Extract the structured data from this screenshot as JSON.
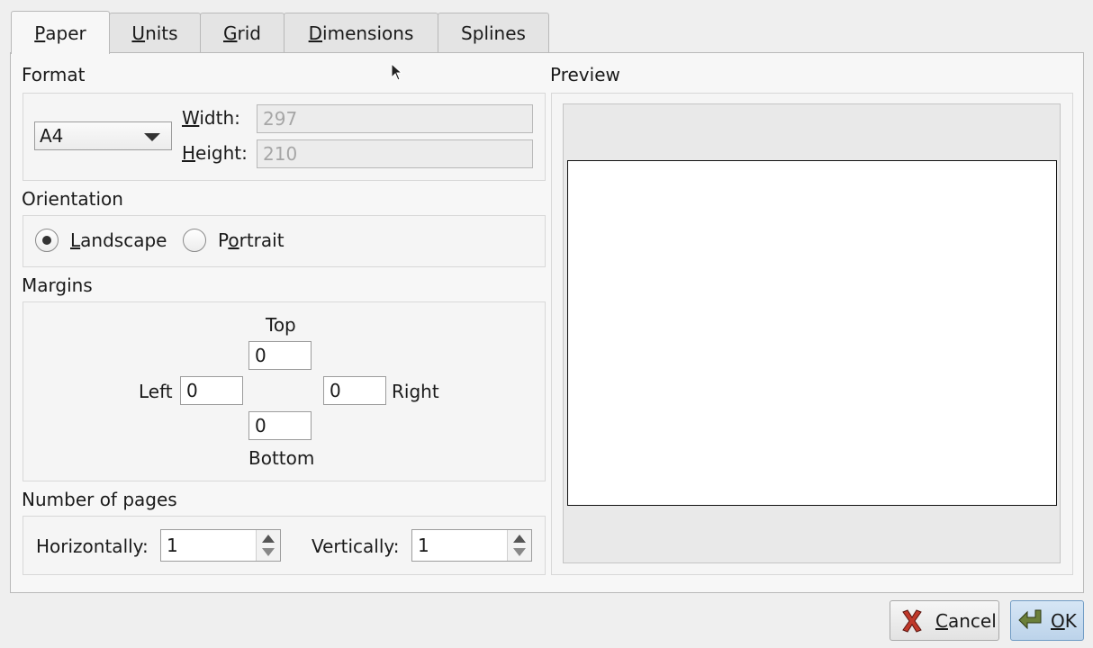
{
  "tabs": [
    {
      "pre": "",
      "key": "P",
      "post": "aper"
    },
    {
      "pre": "",
      "key": "U",
      "post": "nits"
    },
    {
      "pre": "",
      "key": "G",
      "post": "rid"
    },
    {
      "pre": "",
      "key": "D",
      "post": "imensions"
    },
    {
      "pre": "",
      "key": "",
      "post": "Splines"
    }
  ],
  "format": {
    "title": "Format",
    "selected": "A4",
    "width_key": "W",
    "width_rest": "idth:",
    "width_value": "297",
    "height_key": "H",
    "height_rest": "eight:",
    "height_value": "210"
  },
  "orientation": {
    "title": "Orientation",
    "landscape_key": "L",
    "landscape_rest": "andscape",
    "portrait_pre": "P",
    "portrait_key": "o",
    "portrait_rest": "rtrait",
    "selected": "landscape"
  },
  "margins": {
    "title": "Margins",
    "top_label": "Top",
    "top_value": "0",
    "left_label": "Left",
    "left_value": "0",
    "right_label": "Right",
    "right_value": "0",
    "bottom_label": "Bottom",
    "bottom_value": "0"
  },
  "pages": {
    "title": "Number of pages",
    "horizontal_label": "Horizontally:",
    "horizontal_value": "1",
    "vertical_label": "Vertically:",
    "vertical_value": "1"
  },
  "preview": {
    "title": "Preview"
  },
  "buttons": {
    "cancel_key": "C",
    "cancel_rest": "ancel",
    "ok_key": "O",
    "ok_rest": "K"
  },
  "colors": {
    "cancel_icon": "#c0392b",
    "ok_icon": "#6b7f3a",
    "accent": "#6f9bc4"
  }
}
